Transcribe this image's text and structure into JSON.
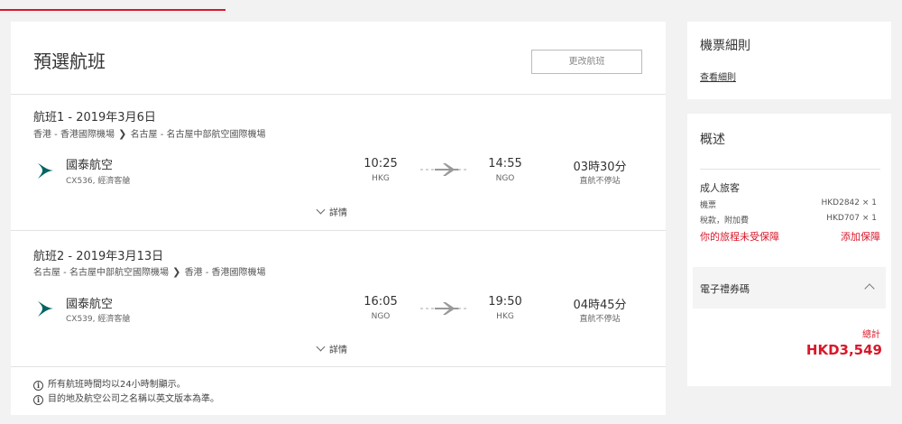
{
  "main": {
    "title": "預選航班",
    "change_button": "更改航班",
    "details_label": "詳情",
    "notes": [
      "所有航班時間均以24小時制顯示。",
      "目的地及航空公司之名稱以英文版本為準。"
    ]
  },
  "legs": [
    {
      "title": "航班1 - 2019年3月6日",
      "route_from": "香港 - 香港國際機場",
      "route_to": "名古屋 - 名古屋中部航空國際機場",
      "airline": "國泰航空",
      "flight_no": "CX536, 經濟客艙",
      "dep_time": "10:25",
      "dep_code": "HKG",
      "arr_time": "14:55",
      "arr_code": "NGO",
      "duration": "03時30分",
      "stops": "直航不停站"
    },
    {
      "title": "航班2 - 2019年3月13日",
      "route_from": "名古屋 - 名古屋中部航空國際機場",
      "route_to": "香港 - 香港國際機場",
      "airline": "國泰航空",
      "flight_no": "CX539, 經濟客艙",
      "dep_time": "16:05",
      "dep_code": "NGO",
      "arr_time": "19:50",
      "arr_code": "HKG",
      "duration": "04時45分",
      "stops": "直航不停站"
    }
  ],
  "fare_rules": {
    "title": "機票細則",
    "link": "查看細則"
  },
  "summary": {
    "title": "概述",
    "passenger_type": "成人旅客",
    "ticket_label": "機票",
    "ticket_value": "HKD2842 × 1",
    "tax_label": "稅款，附加費",
    "tax_value": "HKD707 × 1",
    "insurance_label": "你的旅程未受保障",
    "insurance_link": "添加保障",
    "voucher_label": "電子禮券碼",
    "total_label": "總計",
    "total_value": "HKD3,549"
  },
  "colors": {
    "accent": "#d8182a",
    "airline_logo": "#006564"
  },
  "icons": {
    "airline_logo": "cathay-brushwing-icon",
    "plane": "plane-arrow-icon",
    "info": "info-circle-icon",
    "details_toggle": "chevron-down-icon",
    "route_arrow": "chevron-right-icon",
    "voucher_toggle": "chevron-up-icon"
  }
}
